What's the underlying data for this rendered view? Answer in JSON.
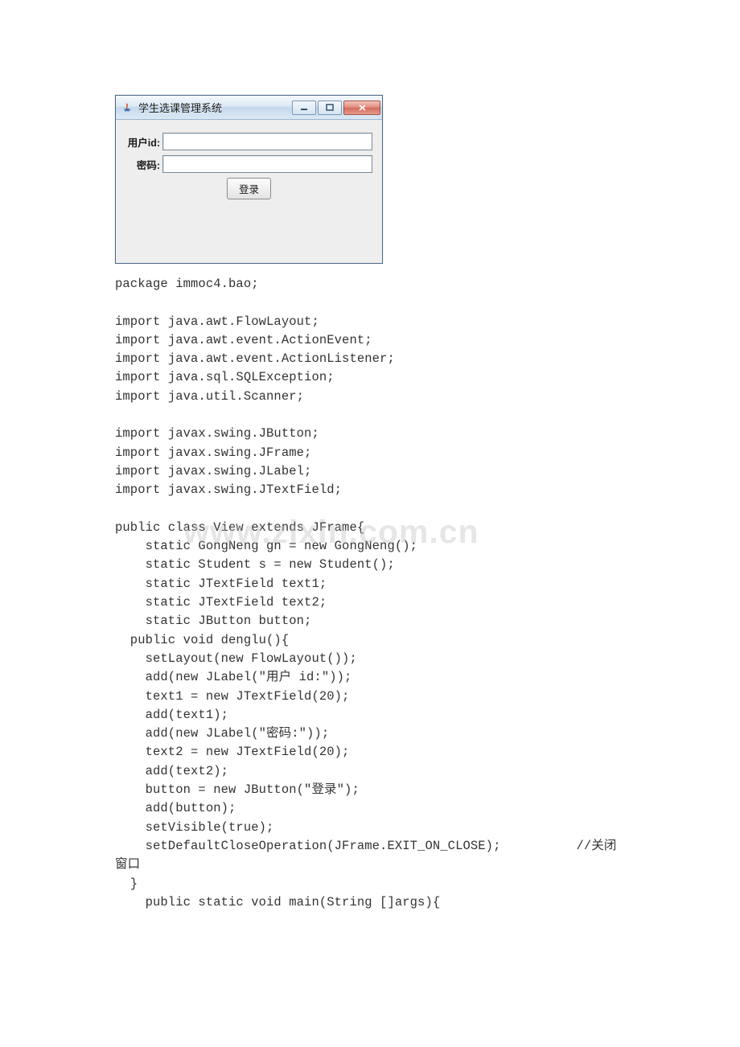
{
  "window": {
    "title": "学生选课管理系统",
    "labels": {
      "user_id": "用户id:",
      "password": "密码:",
      "login": "登录"
    }
  },
  "watermark": "www.zixin.com.cn",
  "code": {
    "lines": [
      "package immoc4.bao;",
      "",
      "import java.awt.FlowLayout;",
      "import java.awt.event.ActionEvent;",
      "import java.awt.event.ActionListener;",
      "import java.sql.SQLException;",
      "import java.util.Scanner;",
      "",
      "import javax.swing.JButton;",
      "import javax.swing.JFrame;",
      "import javax.swing.JLabel;",
      "import javax.swing.JTextField;",
      "",
      "public class View extends JFrame{",
      "    static GongNeng gn = new GongNeng();",
      "    static Student s = new Student();",
      "    static JTextField text1;",
      "    static JTextField text2;",
      "    static JButton button;",
      "  public void denglu(){",
      "    setLayout(new FlowLayout());",
      "    add(new JLabel(\"用户 id:\"));",
      "    text1 = new JTextField(20);",
      "    add(text1);",
      "    add(new JLabel(\"密码:\"));",
      "    text2 = new JTextField(20);",
      "    add(text2);",
      "    button = new JButton(\"登录\");",
      "    add(button);",
      "    setVisible(true);",
      "    setDefaultCloseOperation(JFrame.EXIT_ON_CLOSE);          //关闭",
      "窗口",
      "  }",
      "    public static void main(String []args){"
    ]
  }
}
